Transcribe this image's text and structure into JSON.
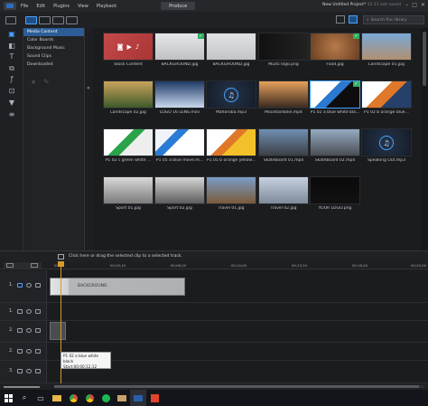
{
  "menu": {
    "items": [
      "File",
      "Edit",
      "Plugins",
      "View",
      "Playback"
    ],
    "mode": "Produce",
    "project_title": "New Untitled Project*",
    "project_sub": " 12:11 last saved",
    "win_controls": [
      "–",
      "□",
      "✕"
    ]
  },
  "toolbar": {
    "search_placeholder": "Search the library"
  },
  "categories": [
    "Media Content",
    "Color Boards",
    "Background Music",
    "Sound Clips",
    "Downloaded"
  ],
  "media": [
    {
      "name": "Stock Content",
      "kind": "stock",
      "color": "#c44a4a"
    },
    {
      "name": "BACKGROUND.jpg",
      "kind": "image",
      "check": true
    },
    {
      "name": "BACKGROUND.jpg",
      "kind": "image"
    },
    {
      "name": "Mud5 logo.png",
      "kind": "logo"
    },
    {
      "name": "Food.jpg",
      "kind": "image",
      "check": true
    },
    {
      "name": "Landscape 01.jpg",
      "kind": "image"
    },
    {
      "name": "Landscape 02.jpg",
      "kind": "image"
    },
    {
      "name": "LOGO 16 LENS.mov",
      "kind": "video"
    },
    {
      "name": "Mahoroba.mp3",
      "kind": "audio"
    },
    {
      "name": "Mountainbike.mp4",
      "kind": "video"
    },
    {
      "name": "P1 02 a blue white bla...",
      "kind": "video",
      "selected": true,
      "check": true
    },
    {
      "name": "P1 02 b orange blue...",
      "kind": "video"
    },
    {
      "name": "P1 02 c green white ...",
      "kind": "video"
    },
    {
      "name": "P1 05 a blue move.m...",
      "kind": "video"
    },
    {
      "name": "P1 05 b orange yellow...",
      "kind": "video"
    },
    {
      "name": "Skateboard 01.mp4",
      "kind": "video"
    },
    {
      "name": "Skateboard 02.mp4",
      "kind": "video"
    },
    {
      "name": "Speaking Out.mp3",
      "kind": "audio"
    },
    {
      "name": "Sport 01.jpg",
      "kind": "image"
    },
    {
      "name": "Sport 02.jpg",
      "kind": "image"
    },
    {
      "name": "Travel 01.jpg",
      "kind": "image"
    },
    {
      "name": "Travel 02.jpg",
      "kind": "image"
    },
    {
      "name": "YOUR LOGO.png",
      "kind": "logo"
    }
  ],
  "timeline": {
    "hint": "Click here or drag the selected clip to a selected track.",
    "ruler": [
      "00;00",
      "00;03;10",
      "00;06;20",
      "00;10;00",
      "00;13;10",
      "00;16;20",
      "00;20;00"
    ],
    "tracks": [
      {
        "num": "1."
      },
      {
        "num": "1."
      },
      {
        "num": "2."
      },
      {
        "num": "2."
      },
      {
        "num": "3."
      }
    ],
    "clip_label": "BACKGROUND",
    "tooltip": {
      "line1": "P1 02 a blue white black",
      "line2": "Start:00;00;12;12",
      "line3": "End:00;00;10;02"
    }
  },
  "taskbar": {
    "icons": [
      "windows-icon",
      "search-icon",
      "task-view-icon",
      "folder-icon",
      "chrome-icon",
      "chrome2-icon",
      "spotify-icon",
      "photo-icon",
      "powerdirector-icon",
      "app-icon"
    ]
  }
}
